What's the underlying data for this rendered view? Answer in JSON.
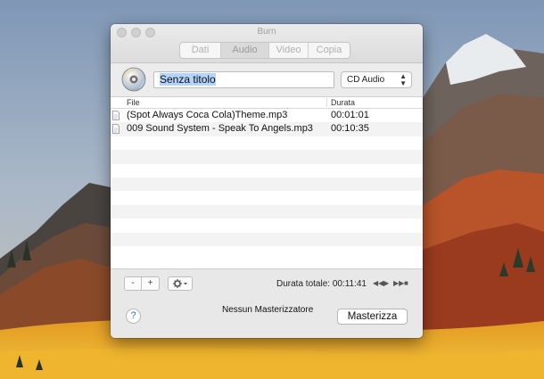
{
  "window": {
    "title": "Burn"
  },
  "tabs": [
    {
      "label": "Dati",
      "active": false
    },
    {
      "label": "Audio",
      "active": true
    },
    {
      "label": "Video",
      "active": false
    },
    {
      "label": "Copia",
      "active": false
    }
  ],
  "disc": {
    "name_value": "Senza titolo",
    "type_selected": "CD Audio"
  },
  "table": {
    "columns": [
      "File",
      "Durata"
    ],
    "rows": [
      {
        "file": "(Spot Always Coca Cola)Theme.mp3",
        "duration": "00:01:01"
      },
      {
        "file": "009 Sound System - Speak To Angels.mp3",
        "duration": "00:10:35"
      }
    ]
  },
  "toolbar": {
    "remove_label": "-",
    "add_label": "+",
    "gear_icon": "gear-icon",
    "total_label": "Durata totale: 00:11:41"
  },
  "footer": {
    "help_label": "?",
    "burner_status": "Nessun Masterizzatore",
    "burn_label": "Masterizza"
  },
  "colors": {
    "selection": "#b3d4fc",
    "help_accent": "#3a6fd8"
  }
}
